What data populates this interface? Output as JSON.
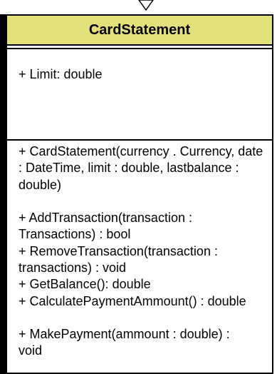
{
  "colors": {
    "header_fill": "#E4E07A",
    "border": "#000000",
    "background": "#FFFFFF"
  },
  "class": {
    "name": "CardStatement",
    "attributes": [
      "+ Limit: double"
    ],
    "operations": [
      "+ CardStatement(currency . Currency, date : DateTime, limit : double, lastbalance : double)",
      "+ AddTransaction(transaction : Transactions) : bool",
      "+ RemoveTransaction(transaction : transactions) : void",
      "+ GetBalance(): double",
      "+ CalculatePaymentAmmount() : double",
      "+ MakePayment(ammount : double) : void"
    ]
  }
}
